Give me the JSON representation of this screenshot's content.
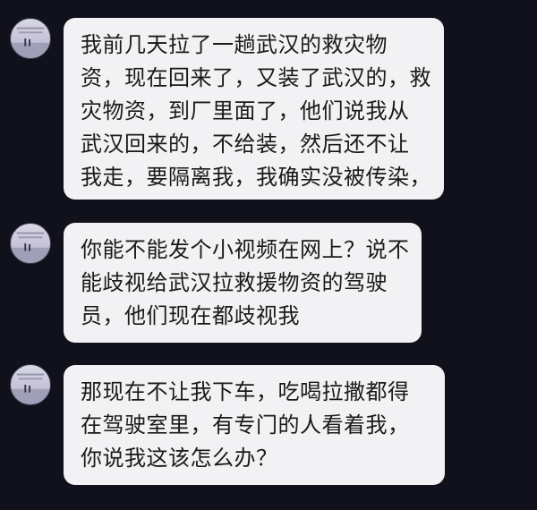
{
  "messages": [
    {
      "lines": [
        "我前几天拉了一趟武汉的救灾物",
        "资，现在回来了，又装了武汉的，救",
        "灾物资，到厂里面了，他们说我从",
        "武汉回来的，不给装，然后还不让",
        "我走，要隔离我，我确实没被传染，"
      ]
    },
    {
      "lines": [
        "你能不能发个小视频在网上？说不",
        "能歧视给武汉拉救援物资的驾驶",
        "员，他们现在都歧视我"
      ]
    },
    {
      "lines": [
        "那现在不让我下车，吃喝拉撒都得",
        "在驾驶室里，有专门的人看着我，",
        "你说我这该怎么办？"
      ]
    }
  ],
  "colors": {
    "background": "#11111c",
    "bubble": "#f2f2f4",
    "text": "#1a1a1a"
  },
  "avatar_icon": "avatar-image-icon"
}
